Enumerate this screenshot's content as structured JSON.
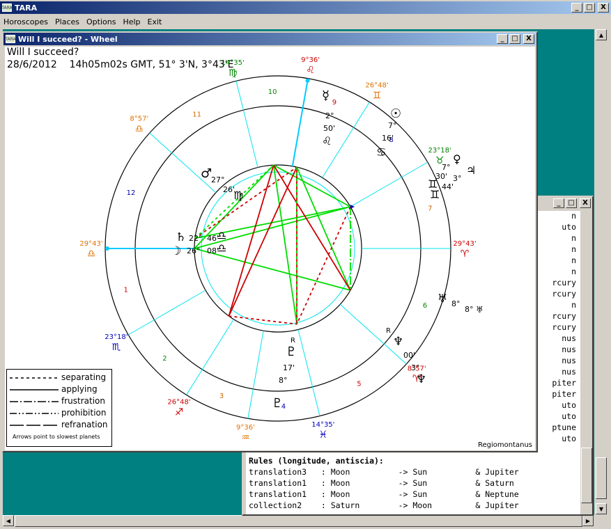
{
  "app": {
    "title": "TARA",
    "icon_text": "TARA"
  },
  "menu": [
    "Horoscopes",
    "Places",
    "Options",
    "Help",
    "Exit"
  ],
  "window_buttons": {
    "minimize": "_",
    "maximize": "□",
    "close": "X"
  },
  "wheel_window": {
    "title": "Will I succeed? - Wheel",
    "question": "Will I succeed?",
    "date_line": "28/6/2012    14h05m02s GMT, 51° 3'N, 3°43'E",
    "house_system": "Regiomontanus"
  },
  "legend": {
    "items": [
      "separating",
      "applying",
      "frustration",
      "prohibition",
      "refranation"
    ],
    "note": "Arrows point to slowest planets"
  },
  "cusps": [
    {
      "deg": "29°43'",
      "sign": "♎"
    },
    {
      "deg": "23°18'",
      "sign": "♏"
    },
    {
      "deg": "26°48'",
      "sign": "♐"
    },
    {
      "deg": "9°36'",
      "sign": "♒"
    },
    {
      "deg": "14°35'",
      "sign": "♓"
    },
    {
      "deg": "8°57'",
      "sign": "♈"
    },
    {
      "deg": "29°43'",
      "sign": "♈"
    },
    {
      "deg": "23°18'",
      "sign": "♉"
    },
    {
      "deg": "26°48'",
      "sign": "♊"
    },
    {
      "deg": "9°36'",
      "sign": "♌"
    },
    {
      "deg": "14°35'",
      "sign": "♍"
    },
    {
      "deg": "8°57'",
      "sign": "♎"
    }
  ],
  "house_numbers": [
    "1",
    "2",
    "3",
    "4",
    "5",
    "6",
    "7",
    "8",
    "9",
    "10",
    "11",
    "12"
  ],
  "planets": {
    "mercury": {
      "glyph": "☿",
      "deg": "2°",
      "min": "50'",
      "sign": "♌"
    },
    "sun": {
      "glyph": "☉",
      "deg": "7°",
      "min": "16'",
      "sign": "♋"
    },
    "venus": {
      "glyph": "♀",
      "deg": "7°",
      "min": "30'",
      "sign": "♊"
    },
    "jupiter": {
      "glyph": "♃",
      "deg": "3°",
      "min": "44'",
      "sign": "♊"
    },
    "mars": {
      "glyph": "♂",
      "deg": "27°",
      "min": "26'",
      "sign": "♍"
    },
    "saturn": {
      "glyph": "♄",
      "deg": "22°",
      "min": "46'",
      "sign": "♎"
    },
    "moon": {
      "glyph": "☽",
      "deg": "26°",
      "min": "08'",
      "sign": "♎"
    },
    "pluto": {
      "glyph": "♇",
      "deg": "8°",
      "min": "17'",
      "sign": "♑",
      "retro": "R"
    },
    "neptune": {
      "glyph": "♆",
      "deg": "3°",
      "min": "00'",
      "sign": "♓",
      "retro": "R"
    },
    "uranus": {
      "glyph": "♅",
      "deg": "8°",
      "min": "27'",
      "sign": "♈"
    }
  },
  "colors": {
    "fire": "#cc0000",
    "earth": "#008000",
    "air": "#e07000",
    "water": "#0000c0"
  },
  "text_window": {
    "list_lines": [
      "n",
      "uto",
      "n",
      "n",
      "n",
      "n",
      "rcury",
      "rcury",
      "n",
      "rcury",
      "rcury",
      "nus",
      "nus",
      "nus",
      "nus",
      "piter",
      "piter",
      "uto",
      "uto",
      "ptune",
      "uto"
    ],
    "rules_header": "Rules (longitude, antiscia):",
    "rules": [
      "translation3   : Moon          -> Sun          & Jupiter",
      "translation1   : Moon          -> Sun          & Saturn",
      "translation1   : Moon          -> Sun          & Neptune",
      "collection2    : Saturn        -> Moon         & Jupiter"
    ]
  }
}
